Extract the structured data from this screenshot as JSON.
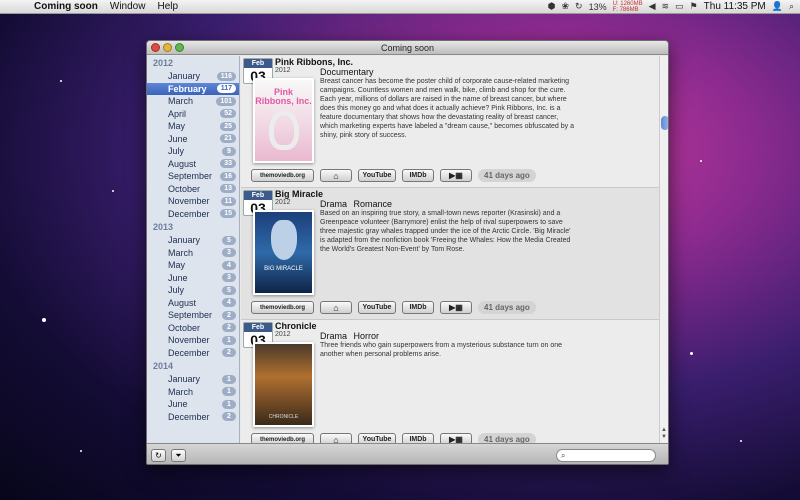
{
  "menubar": {
    "app_name": "Coming soon",
    "menus": [
      "Window",
      "Help"
    ],
    "battery": "13%",
    "memory_u": "U: 1260MB",
    "memory_f": "F:  786MB",
    "clock": "Thu 11:35 PM"
  },
  "window": {
    "title": "Coming soon"
  },
  "sidebar": {
    "years": [
      {
        "year": "2012",
        "months": [
          {
            "label": "January",
            "count": "116"
          },
          {
            "label": "February",
            "count": "117",
            "selected": true
          },
          {
            "label": "March",
            "count": "101"
          },
          {
            "label": "April",
            "count": "52"
          },
          {
            "label": "May",
            "count": "25"
          },
          {
            "label": "June",
            "count": "21"
          },
          {
            "label": "July",
            "count": "9"
          },
          {
            "label": "August",
            "count": "33"
          },
          {
            "label": "September",
            "count": "16"
          },
          {
            "label": "October",
            "count": "13"
          },
          {
            "label": "November",
            "count": "11"
          },
          {
            "label": "December",
            "count": "15"
          }
        ]
      },
      {
        "year": "2013",
        "months": [
          {
            "label": "January",
            "count": "5"
          },
          {
            "label": "March",
            "count": "3"
          },
          {
            "label": "May",
            "count": "4"
          },
          {
            "label": "June",
            "count": "3"
          },
          {
            "label": "July",
            "count": "5"
          },
          {
            "label": "August",
            "count": "4"
          },
          {
            "label": "September",
            "count": "2"
          },
          {
            "label": "October",
            "count": "2"
          },
          {
            "label": "November",
            "count": "1"
          },
          {
            "label": "December",
            "count": "2"
          }
        ]
      },
      {
        "year": "2014",
        "months": [
          {
            "label": "January",
            "count": "1"
          },
          {
            "label": "March",
            "count": "1"
          },
          {
            "label": "June",
            "count": "1"
          },
          {
            "label": "December",
            "count": "2"
          }
        ]
      }
    ]
  },
  "movies": [
    {
      "month": "Feb",
      "day": "03",
      "title": "Pink Ribbons, Inc.",
      "year": "2012",
      "genres": "Documentary",
      "description": "Breast cancer has become the poster child of corporate cause-related marketing campaigns. Countless women and men walk, bike, climb and shop for the cure. Each year, millions of dollars are raised in the name of breast cancer, but where does this money go and what does it actually achieve? Pink Ribbons, Inc. is a feature documentary that shows how the devastating reality of breast cancer, which marketing experts have labeled a \"dream cause,\" becomes obfuscated by a shiny, pink story of success.",
      "poster_text": "Pink Ribbons, Inc.",
      "days_ago": "41 days ago"
    },
    {
      "month": "Feb",
      "day": "03",
      "title": "Big Miracle",
      "year": "2012",
      "genres": "Drama  Romance",
      "description": "Based on an inspiring true story, a small-town news reporter (Krasinski) and a Greenpeace volunteer (Barrymore) enlist the help of rival superpowers to save three majestic gray whales trapped under the ice of the Arctic Circle. 'Big Miracle' is adapted from the nonfiction book 'Freeing the Whales: How the Media Created the World's Greatest Non-Event' by Tom Rose.",
      "poster_text": "BIG MIRACLE",
      "days_ago": "41 days ago"
    },
    {
      "month": "Feb",
      "day": "03",
      "title": "Chronicle",
      "year": "2012",
      "genres": "Drama  Horror",
      "description": "Three friends who gain superpowers from a mysterious substance turn on one another when personal problems arise.",
      "poster_text": "CHRONICLE",
      "days_ago": "41 days ago"
    }
  ],
  "actions": {
    "tmdb": "themoviedb.org",
    "home": "⌂",
    "youtube": "YouTube",
    "imdb": "IMDb",
    "trailer": "▶▦"
  },
  "bottom": {
    "refresh_icon": "↻",
    "filter_icon": "⏷",
    "search_value": "",
    "search_placeholder": ""
  }
}
